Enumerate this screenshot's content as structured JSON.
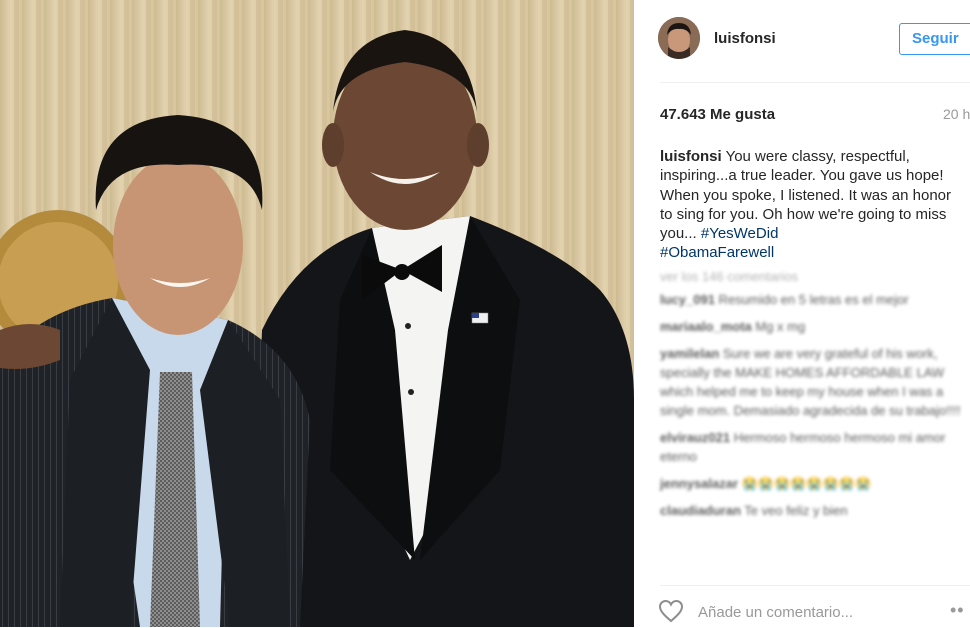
{
  "post": {
    "username": "luisfonsi",
    "follow_label": "Seguir",
    "likes": "47.643 Me gusta",
    "date": "20 h",
    "caption_user": "luisfonsi",
    "caption_text": " You were classy, respectful, inspiring...a true leader. You gave us hope! When you spoke, I listened. It was an honor to sing for you. Oh how we're going to miss you... ",
    "hashtags": [
      "#YesWeDid",
      "#ObamaFarewell"
    ]
  },
  "comments": {
    "view_all": "ver los 146 comentarios",
    "items": [
      {
        "user": "lucy_091",
        "text": " Resumido en 5 letras es el mejor"
      },
      {
        "user": "mariaalo_mota",
        "text": " Mg x mg"
      },
      {
        "user": "yamilelan",
        "text": " Sure we are very grateful of his work, specially the MAKE HOMES AFFORDABLE LAW which helped me to keep my house when I was a single mom. Demasiado agradecida de su trabajo!!!!"
      },
      {
        "user": "elvirauz021",
        "text": " Hermoso hermoso hermoso mi amor eterno"
      },
      {
        "user": "jennysalazar",
        "text": " 😭😭😭😭😭😭😭😭"
      },
      {
        "user": "claudiaduran",
        "text": " Te veo feliz y bien"
      }
    ]
  },
  "footer": {
    "add_comment_placeholder": "Añade un comentario...",
    "more_label": "••"
  },
  "icons": {
    "like": "heart-icon",
    "options": "more-options-icon"
  },
  "colors": {
    "accent": "#3897f0",
    "hashtag": "#003569"
  }
}
